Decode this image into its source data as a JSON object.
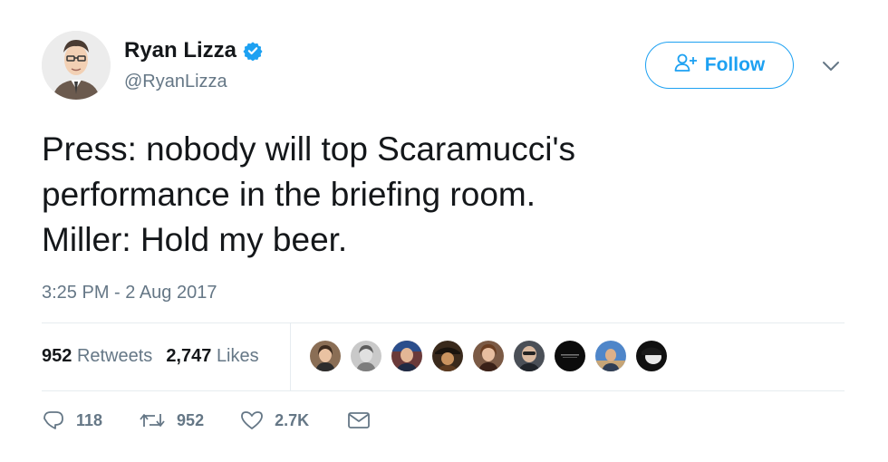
{
  "author": {
    "name": "Ryan Lizza",
    "handle": "@RyanLizza",
    "verified": true,
    "avatar_icon": "caricature-avatar"
  },
  "follow_button": {
    "label": "Follow",
    "icon": "add-user-icon"
  },
  "menu": {
    "icon": "chevron-down-icon"
  },
  "tweet": {
    "lines": [
      "Press: nobody will top Scaramucci's",
      "performance in the briefing room.",
      "Miller: Hold my beer."
    ],
    "timestamp": "3:25 PM - 2 Aug 2017"
  },
  "stats": {
    "retweets_count": "952",
    "retweets_label": "Retweets",
    "likes_count": "2,747",
    "likes_label": "Likes"
  },
  "actions": {
    "reply_count": "118",
    "retweet_count": "952",
    "like_count": "2.7K"
  },
  "colors": {
    "accent": "#1da1f2",
    "text": "#14171a",
    "muted": "#657786",
    "divider": "#e6ecf0"
  }
}
